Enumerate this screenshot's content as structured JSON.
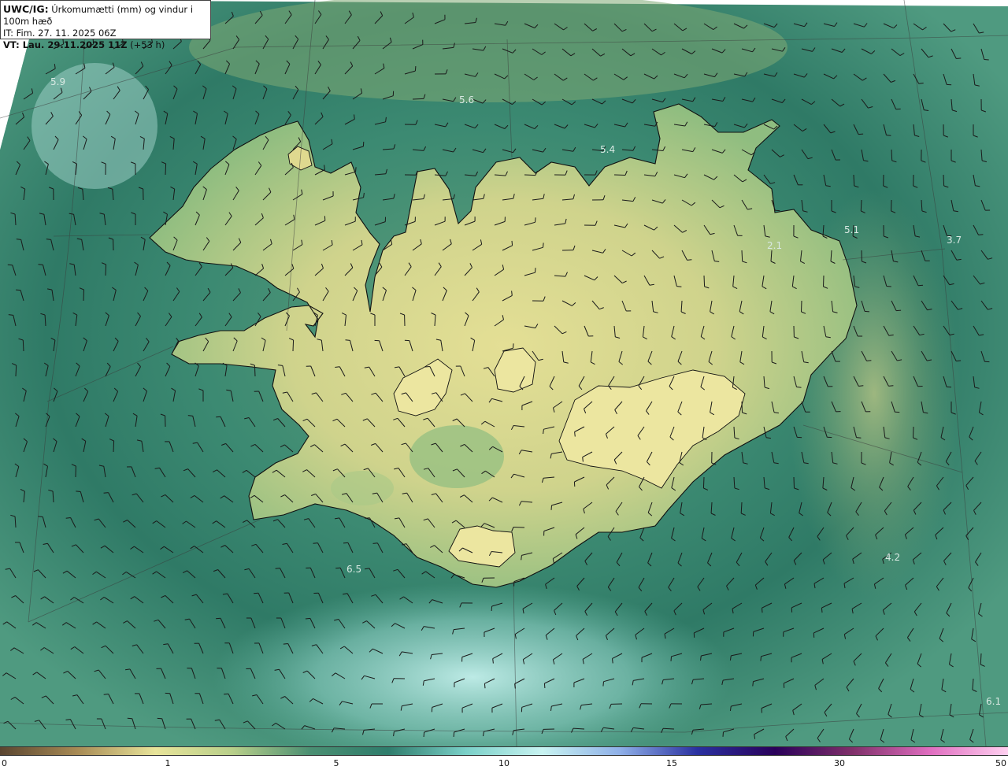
{
  "header": {
    "title_prefix": "UWC/IG:",
    "title_text": " Úrkomumætti (mm) og vindur i 100m hæð",
    "it_line": "IT: Fim. 27. 11. 2025 06Z",
    "vt_prefix": "VT:",
    "vt_text": " Lau. 29.11.2025 11Z",
    "vt_offset": " (+53 h)"
  },
  "map_value_labels": [
    {
      "text": "5.6"
    },
    {
      "text": "5.4"
    },
    {
      "text": "5.1"
    },
    {
      "text": "3.7"
    },
    {
      "text": "6.5"
    },
    {
      "text": "4.2"
    },
    {
      "text": "6.1"
    },
    {
      "text": "5.9"
    },
    {
      "text": "2.1"
    }
  ],
  "colorbar": {
    "ticks": [
      "0",
      "1",
      "5",
      "10",
      "15",
      "30",
      "50"
    ],
    "colors": [
      "#5a4530",
      "#a88b55",
      "#e8e49a",
      "#b8cf8a",
      "#4a8f72",
      "#2f7d6c",
      "#7ad0c8",
      "#c8f3f1",
      "#8fb0e8",
      "#2a30a0",
      "#2a005a",
      "#80306a",
      "#e06ec0",
      "#ffd0f0"
    ]
  },
  "colors": {
    "land_low": "#e6e196",
    "land_mid": "#a8c47e",
    "sea_dark": "#2f7a66",
    "sea_mid": "#4f9a80",
    "sea_light": "#9cd8cf",
    "barb": "#1a1a1a",
    "coast": "#111111"
  }
}
